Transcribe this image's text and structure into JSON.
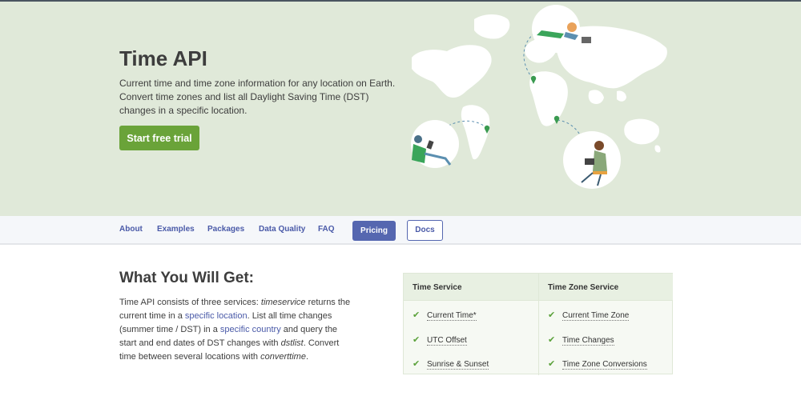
{
  "hero": {
    "title": "Time API",
    "description": "Current time and time zone information for any location on Earth. Convert time zones and list all Daylight Saving Time (DST) changes in a specific location.",
    "cta_label": "Start free trial",
    "accent": "#6aa339",
    "background": "#e0e9d9"
  },
  "nav": {
    "items": [
      {
        "label": "About"
      },
      {
        "label": "Examples"
      },
      {
        "label": "Packages"
      },
      {
        "label": "Data Quality"
      },
      {
        "label": "FAQ"
      }
    ],
    "pricing_label": "Pricing",
    "docs_label": "Docs",
    "link_color": "#4a5aa8"
  },
  "main": {
    "title": "What You Will Get:",
    "text": {
      "p1": "Time API consists of three services: ",
      "em1": "timeservice",
      "p2": " returns the current time in a ",
      "link1": "specific location",
      "p3": ". List all time changes (summer time / DST) in a ",
      "link2": "specific country",
      "p4": " and query the start and end dates of DST changes with ",
      "em2": "dstlist",
      "p5": ". Convert time between several locations with ",
      "em3": "converttime",
      "p6": "."
    }
  },
  "services": {
    "columns": [
      {
        "header": "Time Service",
        "items": [
          "Current Time*",
          "UTC Offset",
          "Sunrise & Sunset"
        ]
      },
      {
        "header": "Time Zone Service",
        "items": [
          "Current Time Zone",
          "Time Changes",
          "Time Zone Conversions"
        ]
      }
    ],
    "check_icon": "check-icon",
    "check_color": "#5aa13a"
  }
}
